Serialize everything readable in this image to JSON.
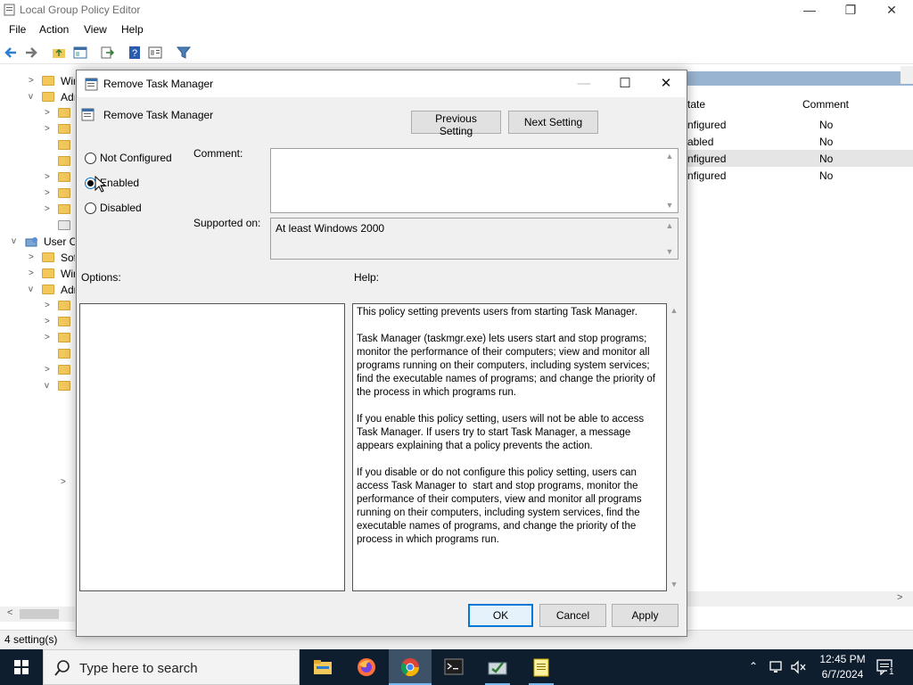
{
  "main_window": {
    "title": "Local Group Policy Editor",
    "menu": [
      "File",
      "Action",
      "View",
      "Help"
    ]
  },
  "tree": [
    {
      "label": "Win",
      "chevron": ">"
    },
    {
      "label": "Adı",
      "chevron": "v"
    },
    {
      "label": "",
      "chevron": ">"
    },
    {
      "label": "",
      "chevron": ">"
    },
    {
      "label": "",
      "chevron": ""
    },
    {
      "label": "",
      "chevron": ""
    },
    {
      "label": "",
      "chevron": ">"
    },
    {
      "label": "",
      "chevron": ">"
    },
    {
      "label": "",
      "chevron": ">"
    },
    {
      "label": "",
      "chevron": ""
    },
    {
      "label": "User Co",
      "chevron": "v"
    },
    {
      "label": "Sof",
      "chevron": ">"
    },
    {
      "label": "Wir",
      "chevron": ">"
    },
    {
      "label": "Adr",
      "chevron": "v"
    },
    {
      "label": "",
      "chevron": ">"
    },
    {
      "label": "",
      "chevron": ">"
    },
    {
      "label": "",
      "chevron": ">"
    },
    {
      "label": "",
      "chevron": ""
    },
    {
      "label": "",
      "chevron": ">"
    },
    {
      "label": "",
      "chevron": "v"
    }
  ],
  "list": {
    "columns": [
      "tate",
      "Comment"
    ],
    "rows": [
      {
        "state": "nfigured",
        "comment": "No"
      },
      {
        "state": "abled",
        "comment": "No"
      },
      {
        "state": "nfigured",
        "comment": "No"
      },
      {
        "state": "nfigured",
        "comment": "No"
      }
    ]
  },
  "status": "4 setting(s)",
  "dialog": {
    "title": "Remove Task Manager",
    "policy_name": "Remove Task Manager",
    "previous_label": "Previous Setting",
    "next_label": "Next Setting",
    "radio_not_configured": "Not Configured",
    "radio_enabled": "Enabled",
    "radio_disabled": "Disabled",
    "selected": "Enabled",
    "comment_label": "Comment:",
    "comment_value": "",
    "supported_label": "Supported on:",
    "supported_value": "At least Windows 2000",
    "options_label": "Options:",
    "help_label": "Help:",
    "help_text": "This policy setting prevents users from starting Task Manager.\n\nTask Manager (taskmgr.exe) lets users start and stop programs; monitor the performance of their computers; view and monitor all programs running on their computers, including system services; find the executable names of programs; and change the priority of the process in which programs run.\n\nIf you enable this policy setting, users will not be able to access Task Manager. If users try to start Task Manager, a message appears explaining that a policy prevents the action.\n\nIf you disable or do not configure this policy setting, users can access Task Manager to  start and stop programs, monitor the performance of their computers, view and monitor all programs running on their computers, including system services, find the executable names of programs, and change the priority of the process in which programs run.",
    "ok_label": "OK",
    "cancel_label": "Cancel",
    "apply_label": "Apply"
  },
  "taskbar": {
    "search_placeholder": "Type here to search",
    "time": "12:45 PM",
    "date": "6/7/2024",
    "notification_count": "1"
  },
  "colors": {
    "taskbar_bg": "#0f1e2e",
    "accent": "#0078d7",
    "list_header": "#99b4d1"
  }
}
